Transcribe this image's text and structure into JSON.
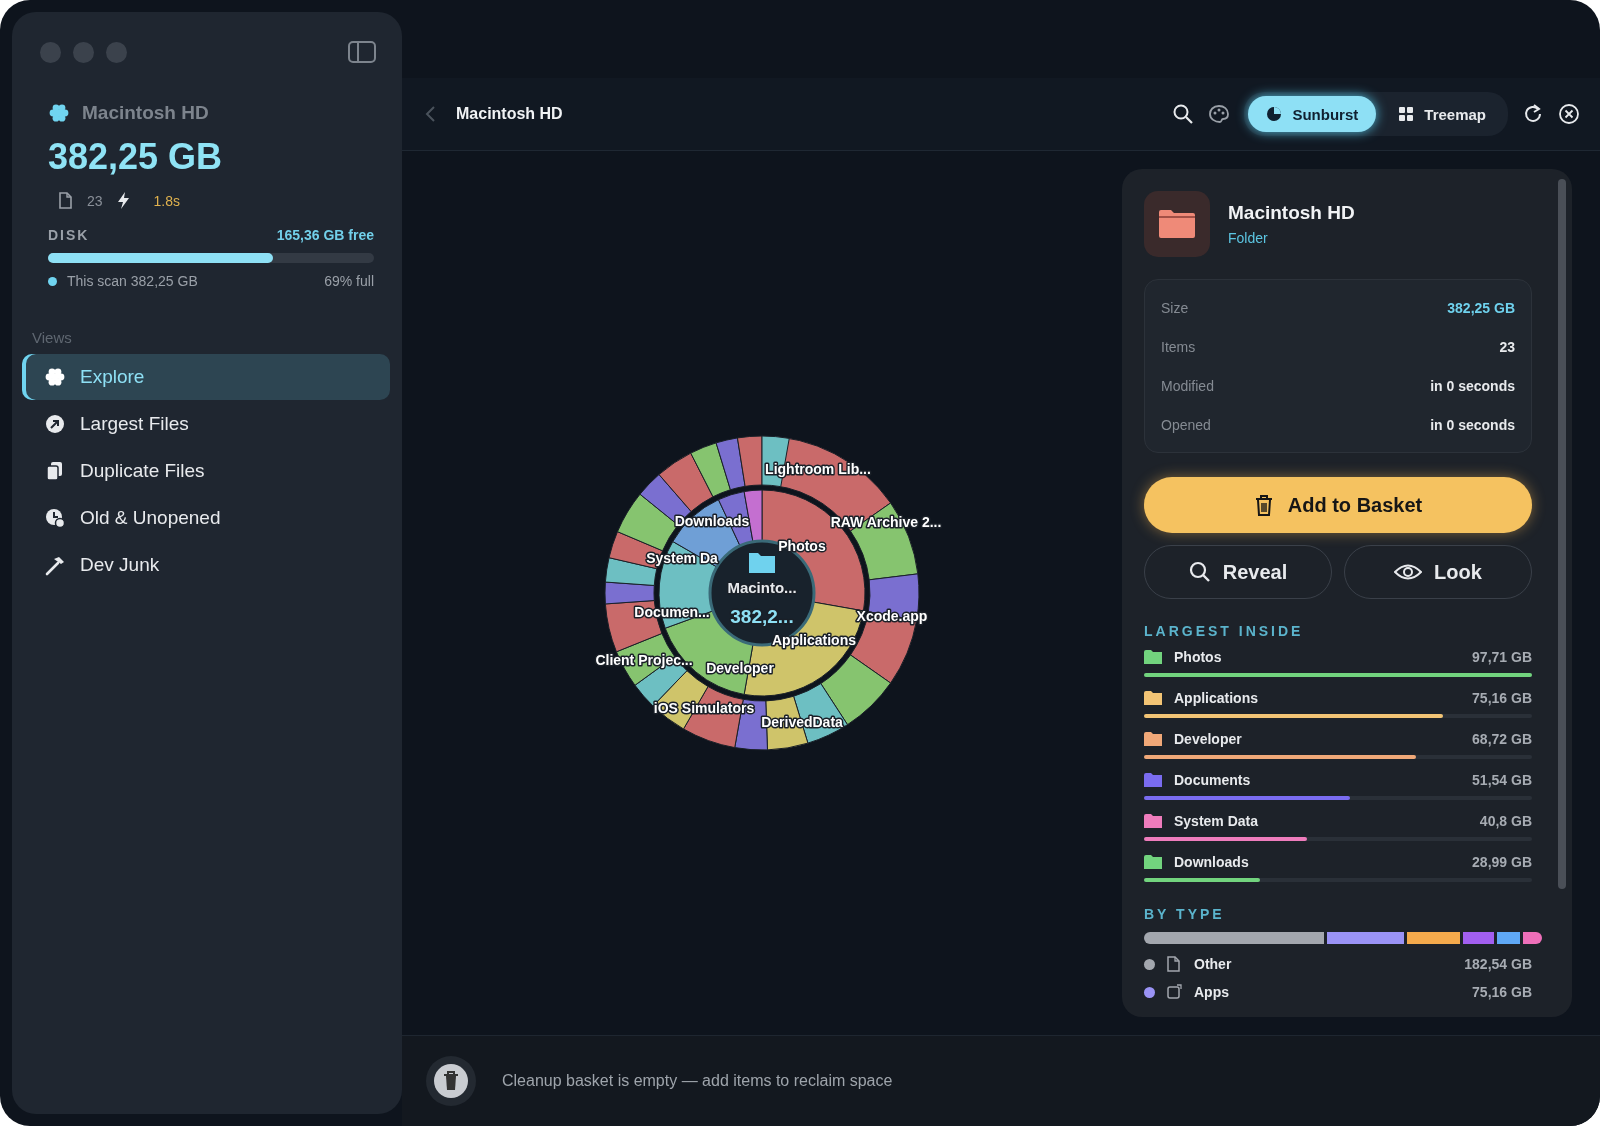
{
  "sidebar": {
    "volume_name": "Macintosh HD",
    "total_size": "382,25 GB",
    "item_count": "23",
    "scan_time": "1.8s",
    "disk": {
      "label": "DISK",
      "free": "165,36 GB free",
      "level": 0.69,
      "scan_label": "This scan 382,25 GB",
      "percent": "69% full"
    },
    "views_heading": "Views",
    "items": [
      {
        "label": "Explore",
        "kind": "explore",
        "selected": true
      },
      {
        "label": "Largest Files",
        "kind": "largest",
        "selected": false
      },
      {
        "label": "Duplicate Files",
        "kind": "duplicate",
        "selected": false
      },
      {
        "label": "Old & Unopened",
        "kind": "old",
        "selected": false
      },
      {
        "label": "Dev Junk",
        "kind": "junk",
        "selected": false
      }
    ]
  },
  "toolbar": {
    "title": "Macintosh HD",
    "view_modes": [
      {
        "label": "Sunburst",
        "kind": "sunburst",
        "selected": true
      },
      {
        "label": "Treemap",
        "kind": "treemap",
        "selected": false
      }
    ]
  },
  "sunburst": {
    "center_name": "Macinto...",
    "center_size": "382,2...",
    "labels": [
      "Lightroom Lib...",
      "RAW Archive 2...",
      "Photos",
      "Downloads",
      "System Da",
      "Documen...",
      "Client Projec...",
      "Developer",
      "Applications",
      "Xcode.app",
      "iOS Simulators",
      "DerivedData"
    ]
  },
  "details": {
    "name": "Macintosh HD",
    "type": "Folder",
    "properties": [
      {
        "label": "Size",
        "value": "382,25 GB",
        "highlight": true
      },
      {
        "label": "Items",
        "value": "23",
        "highlight": false
      },
      {
        "label": "Modified",
        "value": "in 0 seconds",
        "highlight": false
      },
      {
        "label": "Opened",
        "value": "in 0 seconds",
        "highlight": false
      }
    ],
    "primary_action": "Add to Basket",
    "actions": [
      {
        "label": "Reveal",
        "kind": "reveal"
      },
      {
        "label": "Look",
        "kind": "look"
      }
    ],
    "largest_heading": "LARGEST INSIDE",
    "largest": [
      {
        "name": "Photos",
        "size": "97,71 GB",
        "level": 1.0,
        "color": "#72d47e"
      },
      {
        "name": "Applications",
        "size": "75,16 GB",
        "level": 0.77,
        "color": "#f2c475"
      },
      {
        "name": "Developer",
        "size": "68,72 GB",
        "level": 0.7,
        "color": "#f0a878"
      },
      {
        "name": "Documents",
        "size": "51,54 GB",
        "level": 0.53,
        "color": "#7a6cf0"
      },
      {
        "name": "System Data",
        "size": "40,8 GB",
        "level": 0.42,
        "color": "#ee7cbc"
      },
      {
        "name": "Downloads",
        "size": "28,99 GB",
        "level": 0.3,
        "color": "#72d47e"
      }
    ],
    "type_heading": "BY TYPE",
    "type_bar": [
      {
        "color": "#a3a7ae"
      },
      {
        "color": "#9a93f5"
      },
      {
        "color": "#f4aa4c"
      },
      {
        "color": "#a25ff0"
      },
      {
        "color": "#5fa8f5"
      },
      {
        "color": "#ee6fb9"
      }
    ],
    "types": [
      {
        "name": "Other",
        "size": "182,54 GB",
        "kind": "file",
        "color": "#a3a7ae"
      },
      {
        "name": "Apps",
        "size": "75,16 GB",
        "kind": "app",
        "color": "#9a93f5"
      }
    ]
  },
  "basket": {
    "message": "Cleanup basket is empty — add items to reclaim space"
  }
}
